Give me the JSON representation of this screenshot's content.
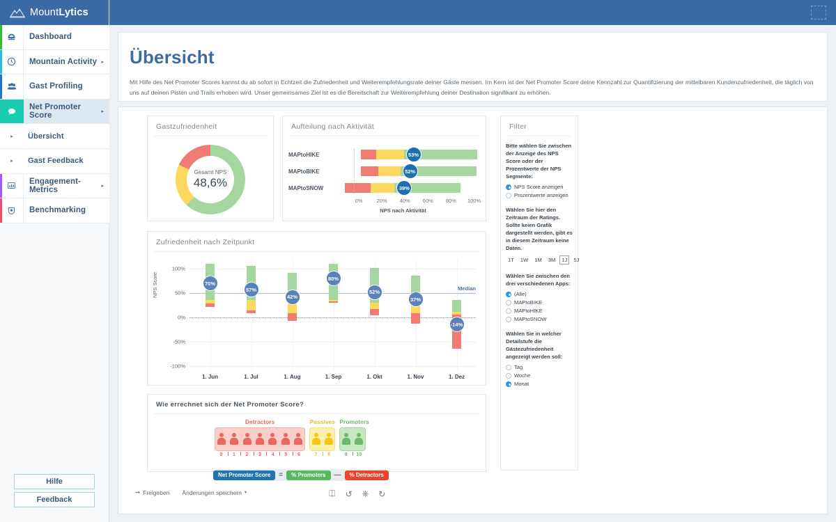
{
  "brand": {
    "name_light": "Mount",
    "name_bold": "Lytics",
    "icon": "mountain-icon"
  },
  "sidebar": {
    "items": [
      {
        "label": "Dashboard",
        "icon": "dashboard-icon",
        "accent": "#2fc22f",
        "caret": "",
        "active": false
      },
      {
        "label": "Mountain Activity",
        "icon": "clock-icon",
        "accent": "#25c1d6",
        "caret": "▸",
        "active": false
      },
      {
        "label": "Gast Profiling",
        "icon": "users-icon",
        "accent": "#1e72d0",
        "caret": "",
        "active": false
      },
      {
        "label": "Net Promoter Score",
        "icon": "chat-icon",
        "accent": "#19cdb0",
        "caret": "▸",
        "active": true
      }
    ],
    "subitems": [
      {
        "label": "Übersicht",
        "caret": "▸"
      },
      {
        "label": "Gast Feedback",
        "caret": "▸"
      }
    ],
    "items_after": [
      {
        "label": "Engagement-Metrics",
        "icon": "bar-chart-icon",
        "accent": "#a855f7",
        "caret": "▸",
        "active": false
      },
      {
        "label": "Benchmarking",
        "icon": "shield-icon",
        "accent": "#f0506e",
        "caret": "",
        "active": false
      }
    ],
    "buttons": [
      {
        "label": "Hilfe"
      },
      {
        "label": "Feedback"
      }
    ]
  },
  "header": {
    "title": "Übersicht",
    "description": "Mit Hilfe des Net Promoter Scores kannst du ab sofort in Echtzeit die Zufriedenheit und Weiterempfehlungsrate deiner Gäste messen. Im Kern ist der Net Promoter Score deine Kennzahl zur Quantifizierung der mittelbaren Kundenzufriedenheit, die täglich von uns auf deinen Pisten und Trails erhoben wird. Unser gemeinsames Ziel ist es die Bereitschaft zur Weiterempfehlung deiner Destination signifikant zu erhöhen."
  },
  "cards": {
    "donut": {
      "title": "Gastzufriedenheit",
      "center_label": "Gesamt NPS",
      "center_value": "48,6%"
    },
    "activity": {
      "title": "Aufteilung nach Aktivität",
      "xlabel": "NPS nach Aktivität"
    },
    "timeline": {
      "title": "Zufriedenheit nach Zeitpunkt",
      "ylabel": "NPS Score",
      "median_label": "Median"
    },
    "nps": {
      "title": "Wie errechnet sich der Net Promoter Score?"
    }
  },
  "filter": {
    "title": "Filter",
    "q1": "Bitte wählen Sie zwischen der Anzeige des NPS Score oder der Prozentwerte der NPS Segmente:",
    "q1_options": [
      {
        "label": "NPS Score anzeigen",
        "selected": true
      },
      {
        "label": "Prozentwerte anzeigen",
        "selected": false
      }
    ],
    "q2": "Wählen Sie hier den Zeitraum der Ratings. Sollte keien Grafik dargestellt werden, gibt es in diesem Zeitraum keine Daten.",
    "periods": [
      {
        "label": "1T",
        "selected": false
      },
      {
        "label": "1W",
        "selected": false
      },
      {
        "label": "1M",
        "selected": false
      },
      {
        "label": "3M",
        "selected": false
      },
      {
        "label": "1J",
        "selected": true
      },
      {
        "label": "5J",
        "selected": false
      }
    ],
    "q3": "Wählen Sie zwischen den drei verschiedenen Apps:",
    "q3_options": [
      {
        "label": "(Alle)",
        "selected": true
      },
      {
        "label": "MAPtoBIKE",
        "selected": false
      },
      {
        "label": "MAPtoHIKE",
        "selected": false
      },
      {
        "label": "MAPtoSNOW",
        "selected": false
      }
    ],
    "q4": "Wählen Sie in welcher Detailstufe die Gästezufriedenheit angezeigt werden soll:",
    "q4_options": [
      {
        "label": "Tag",
        "selected": false
      },
      {
        "label": "Woche",
        "selected": false
      },
      {
        "label": "Monat",
        "selected": true
      }
    ]
  },
  "nps_explainer": {
    "groups": [
      {
        "name": "Detractors",
        "color": "#e8685c",
        "numbers": [
          "0",
          "1",
          "2",
          "3",
          "4",
          "5",
          "6"
        ]
      },
      {
        "name": "Passives",
        "color": "#e8bf2e",
        "numbers": [
          "7",
          "8"
        ]
      },
      {
        "name": "Promoters",
        "color": "#6cba68",
        "numbers": [
          "9",
          "10"
        ]
      }
    ],
    "formula": [
      {
        "text": "Net Promoter Score",
        "style": "blue"
      },
      {
        "text": "=",
        "style": "op"
      },
      {
        "text": "% Promoters",
        "style": "green"
      },
      {
        "text": "—",
        "style": "op"
      },
      {
        "text": "% Detractors",
        "style": "red"
      }
    ]
  },
  "toolbar": {
    "share_label": "Freigeben",
    "save_label": "Änderungen speichern",
    "icons": [
      "upload-icon",
      "undo-icon",
      "power-icon",
      "refresh-icon"
    ]
  },
  "colors": {
    "brand_blue": "#3b6ba5",
    "red": "#f07b72",
    "yellow": "#fbd85e",
    "green": "#a5d6a0",
    "bubble_blue": "#1c6fb0",
    "teal": "#19cdb0"
  },
  "chart_data": [
    {
      "type": "pie",
      "title": "Gastzufriedenheit",
      "labels": [
        "Promoters",
        "Passives",
        "Detractors"
      ],
      "values": [
        62,
        20,
        18
      ],
      "colors": [
        "#a5d6a0",
        "#fbd85e",
        "#f07b72"
      ],
      "center_label": "Gesamt NPS",
      "center_value": "48,6%",
      "legend": "none"
    },
    {
      "type": "bar",
      "orientation": "horizontal",
      "title": "Aufteilung nach Aktivität",
      "xlabel": "NPS nach Aktivität",
      "ylabel": "",
      "categories": [
        "MAPtoHIKE",
        "MAPtoBIKE",
        "MAPtoSNOW"
      ],
      "xticks": [
        "0%",
        "20%",
        "40%",
        "60%",
        "80%",
        "100%"
      ],
      "xlim": [
        -20,
        110
      ],
      "grid": false,
      "nps_labels": [
        "53%",
        "52%",
        "39%"
      ],
      "series": [
        {
          "name": "Detractors",
          "color": "#f07b72",
          "start": [
            2,
            2,
            -12
          ],
          "end": [
            15,
            17,
            10
          ]
        },
        {
          "name": "Passives",
          "color": "#fbd85e",
          "start": [
            15,
            17,
            10
          ],
          "end": [
            39,
            36,
            31
          ]
        },
        {
          "name": "Promoters",
          "color": "#a5d6a0",
          "start": [
            39,
            36,
            31
          ],
          "end": [
            103,
            102,
            88
          ]
        }
      ]
    },
    {
      "type": "bar",
      "orientation": "vertical",
      "title": "Zufriedenheit nach Zeitpunkt",
      "xlabel": "",
      "ylabel": "NPS Score",
      "categories": [
        "1. Jun",
        "1. Jul",
        "1. Aug",
        "1. Sep",
        "1. Okt",
        "1. Nov",
        "1. Dez"
      ],
      "yticks": [
        "-100%",
        "-50%",
        "0%",
        "50%",
        "100%"
      ],
      "ylim": [
        -100,
        115
      ],
      "grid": true,
      "median": 51,
      "median_label": "Median",
      "nps_labels": [
        "70%",
        "57%",
        "42%",
        "80%",
        "52%",
        "37%",
        "-14%"
      ],
      "nps_values": [
        70,
        57,
        42,
        80,
        52,
        37,
        -14
      ],
      "series": [
        {
          "name": "Detractors",
          "color": "#f07b72",
          "start": [
            22,
            9,
            -7,
            31,
            4,
            -12,
            -64
          ],
          "end": [
            29,
            15,
            9,
            33,
            18,
            9,
            6
          ]
        },
        {
          "name": "Passives",
          "color": "#fbd85e",
          "start": [
            29,
            15,
            9,
            33,
            18,
            9,
            6
          ],
          "end": [
            36,
            36,
            45,
            36,
            31,
            29,
            12
          ]
        },
        {
          "name": "Promoters",
          "color": "#a5d6a0",
          "start": [
            36,
            36,
            45,
            36,
            31,
            29,
            12
          ],
          "end": [
            111,
            107,
            92,
            111,
            102,
            87,
            36
          ]
        }
      ]
    }
  ]
}
